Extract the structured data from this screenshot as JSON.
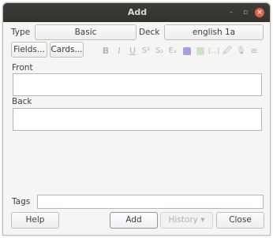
{
  "window": {
    "title": "Add",
    "minimize_glyph": "–",
    "maximize_glyph": "▫",
    "close_glyph": "×"
  },
  "row1": {
    "type_label": "Type",
    "type_value": "Basic",
    "deck_label": "Deck",
    "deck_value": "english 1a"
  },
  "toolbar": {
    "fields_label": "Fields...",
    "cards_label": "Cards...",
    "icons": {
      "bold": "B",
      "italic": "I",
      "underline": "U",
      "superscript": "S²",
      "subscript": "S₂",
      "clear": "Eₓ",
      "cloze": "[...]",
      "attach": "🖉",
      "record": "🎙",
      "more": "≡"
    },
    "text_color": "#a3a1e0",
    "highlight_color": "#c9e5c6"
  },
  "fields": {
    "front_label": "Front",
    "front_value": "",
    "back_label": "Back",
    "back_value": ""
  },
  "tags": {
    "label": "Tags",
    "value": ""
  },
  "bottom": {
    "help_label": "Help",
    "add_label": "Add",
    "history_label": "History ▾",
    "close_label": "Close"
  }
}
